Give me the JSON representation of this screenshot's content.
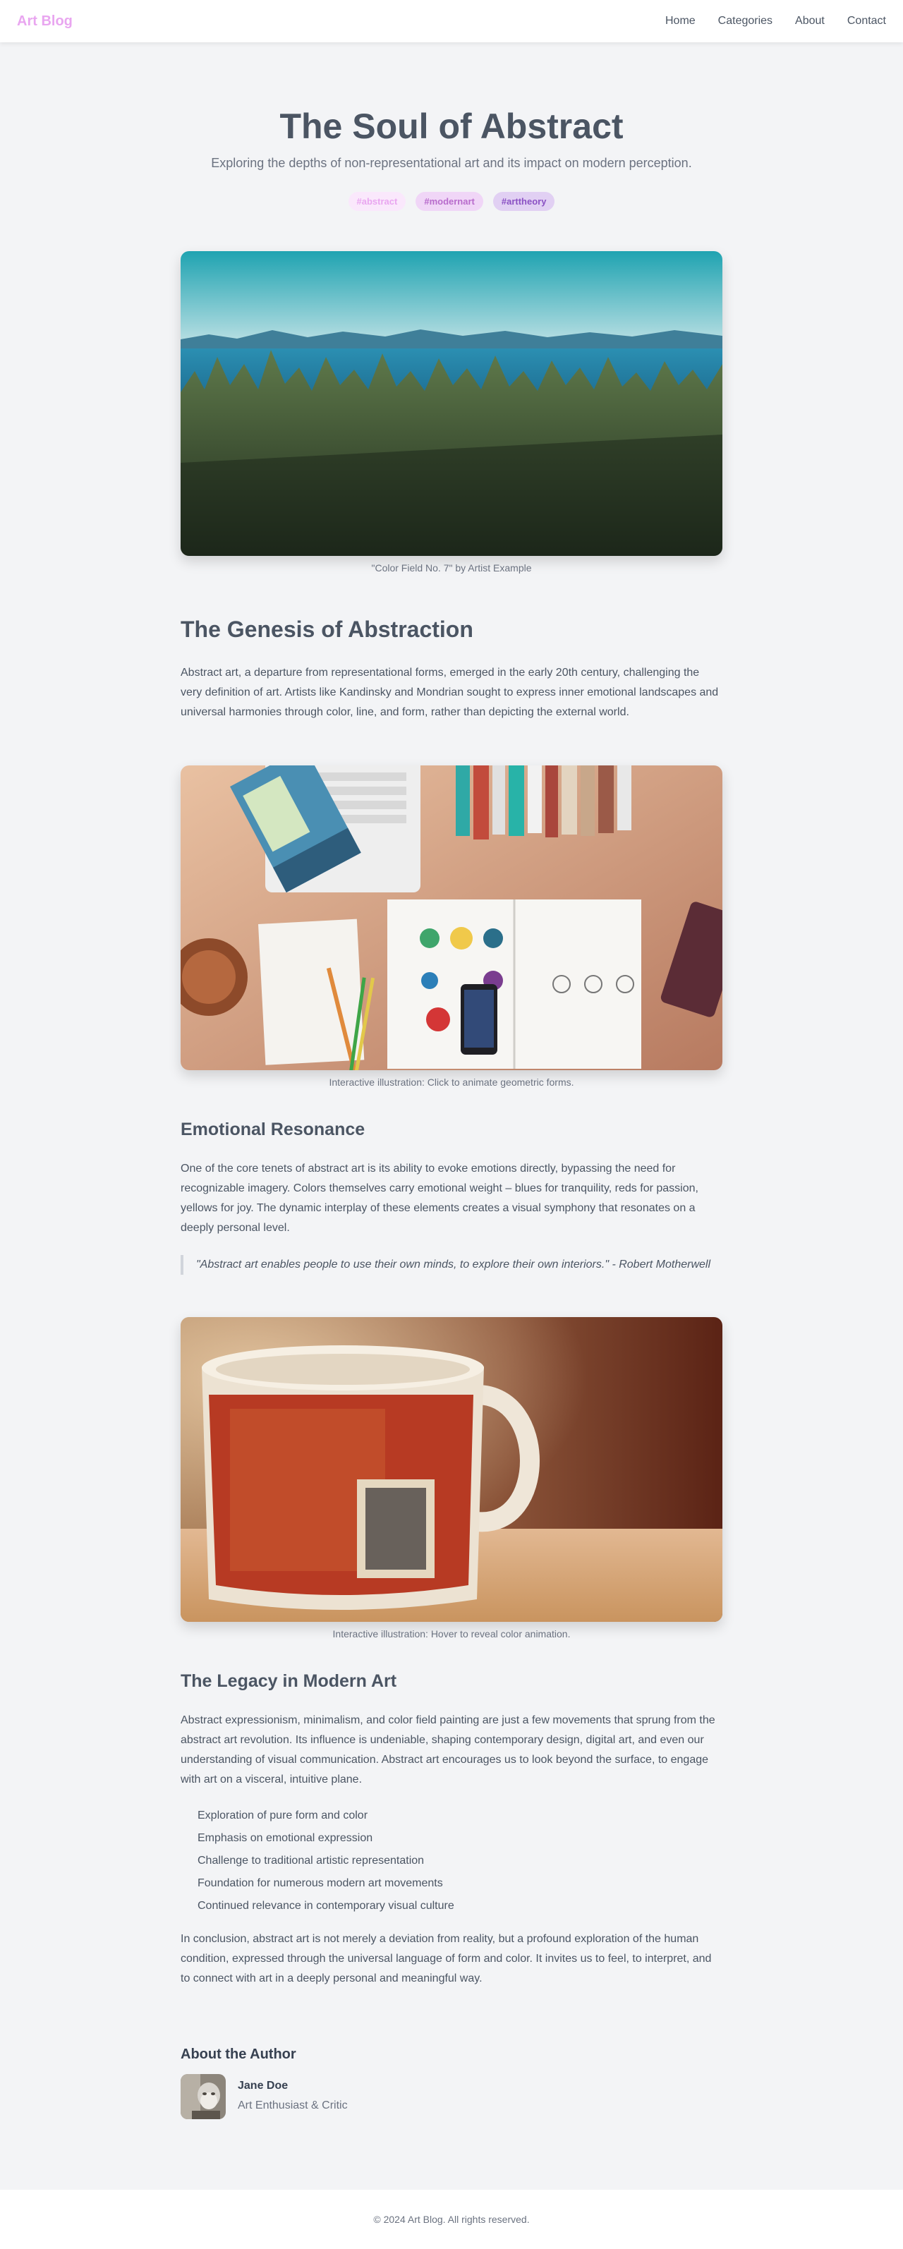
{
  "header": {
    "logo": "Art Blog",
    "nav": [
      "Home",
      "Categories",
      "About",
      "Contact"
    ]
  },
  "hero": {
    "title": "The Soul of Abstract",
    "subtitle": "Exploring the depths of non-representational art and its impact on modern perception.",
    "tags": [
      "#abstract",
      "#modernart",
      "#arttheory"
    ]
  },
  "figures": {
    "hero_caption": "\"Color Field No. 7\" by Artist Example",
    "desk_caption": "Interactive illustration: Click to animate geometric forms.",
    "mug_caption": "Interactive illustration: Hover to reveal color animation."
  },
  "sections": {
    "genesis": {
      "heading": "The Genesis of Abstraction",
      "text": "Abstract art, a departure from representational forms, emerged in the early 20th century, challenging the very definition of art. Artists like Kandinsky and Mondrian sought to express inner emotional landscapes and universal harmonies through color, line, and form, rather than depicting the external world."
    },
    "emotional": {
      "heading": "Emotional Resonance",
      "text": "One of the core tenets of abstract art is its ability to evoke emotions directly, bypassing the need for recognizable imagery. Colors themselves carry emotional weight – blues for tranquility, reds for passion, yellows for joy. The dynamic interplay of these elements creates a visual symphony that resonates on a deeply personal level.",
      "quote": "\"Abstract art enables people to use their own minds, to explore their own interiors.\" - Robert Motherwell"
    },
    "legacy": {
      "heading": "The Legacy in Modern Art",
      "text": "Abstract expressionism, minimalism, and color field painting are just a few movements that sprung from the abstract art revolution. Its influence is undeniable, shaping contemporary design, digital art, and even our understanding of visual communication. Abstract art encourages us to look beyond the surface, to engage with art on a visceral, intuitive plane.",
      "items": [
        "Exploration of pure form and color",
        "Emphasis on emotional expression",
        "Challenge to traditional artistic representation",
        "Foundation for numerous modern art movements",
        "Continued relevance in contemporary visual culture"
      ],
      "conclusion": "In conclusion, abstract art is not merely a deviation from reality, but a profound exploration of the human condition, expressed through the universal language of form and color. It invites us to feel, to interpret, and to connect with art in a deeply personal and meaningful way."
    }
  },
  "author": {
    "heading": "About the Author",
    "name": "Jane Doe",
    "role": "Art Enthusiast & Critic"
  },
  "footer": {
    "text": "© 2024 Art Blog. All rights reserved."
  },
  "colors": {
    "accent": "#e9a6f0",
    "background": "#f3f4f6",
    "text": "#4b5563"
  }
}
